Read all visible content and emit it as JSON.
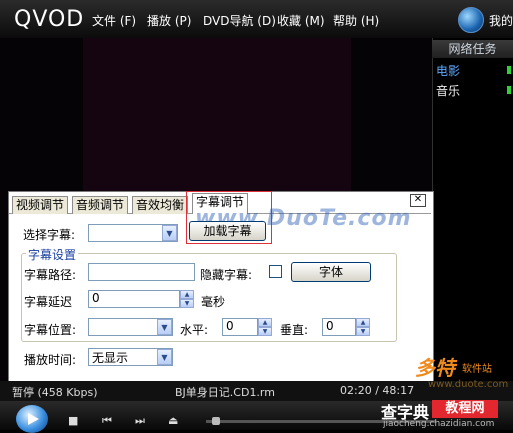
{
  "app": {
    "logo": "QVOD",
    "user_label": "我的"
  },
  "menu": [
    {
      "label": "文件 (F)"
    },
    {
      "label": "播放 (P)"
    },
    {
      "label": "DVD导航 (D)"
    },
    {
      "label": "收藏 (M)"
    },
    {
      "label": "帮助 (H)"
    }
  ],
  "right_panel": {
    "title": "网络任务",
    "items": [
      {
        "label": "电影",
        "active": true
      },
      {
        "label": "音乐",
        "active": false
      }
    ]
  },
  "dialog": {
    "tabs": [
      "视频调节",
      "音频调节",
      "音效均衡",
      "字幕调节"
    ],
    "active_tab": "字幕调节",
    "close_glyph": "✕",
    "select_subtitle_label": "选择字幕:",
    "select_subtitle_value": "",
    "load_button": "加载字幕",
    "group_title": "字幕设置",
    "path_label": "字幕路径:",
    "path_value": "",
    "hide_label": "隐藏字幕:",
    "hide_checked": false,
    "font_button": "字体",
    "delay_label": "字幕延迟",
    "delay_value": "0",
    "delay_unit": "毫秒",
    "position_label": "字幕位置:",
    "position_value": "",
    "horizontal_label": "水平:",
    "horizontal_value": "0",
    "vertical_label": "垂直:",
    "vertical_value": "0",
    "playtime_label": "播放时间:",
    "playtime_value": "无显示"
  },
  "watermark": "www.DuoTe.com",
  "status": {
    "state": "暂停 (458 Kbps)",
    "filename": "BJ单身日记.CD1.rm",
    "time": "02:20 / 48:17"
  },
  "controls": {
    "stop": "■",
    "prev": "⏮",
    "next": "⏭",
    "open": "⏏"
  },
  "site_marks": {
    "duote": "多特",
    "duote_sub": "软件站",
    "duote_url": "www.duote.com",
    "chazidian": "查字典",
    "jiaocheng": "教程网",
    "chazidian_url": "jiaocheng.chazidian.com"
  }
}
